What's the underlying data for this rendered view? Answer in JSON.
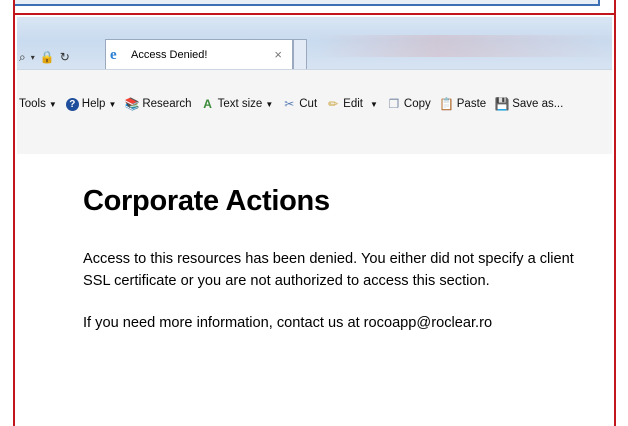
{
  "browser": {
    "tab_title": "Access Denied!",
    "tab_close": "×",
    "address_tools": [
      "search-icon",
      "dropdown-icon",
      "lock-icon",
      "refresh-icon"
    ]
  },
  "commandbar": {
    "items": [
      {
        "label": "Tools",
        "icon": "none",
        "dropdown": true
      },
      {
        "label": "Help",
        "icon": "help-icon",
        "dropdown": true
      },
      {
        "label": "Research",
        "icon": "research-icon",
        "dropdown": false
      },
      {
        "label": "Text size",
        "icon": "text-size-icon",
        "dropdown": true
      },
      {
        "label": "Cut",
        "icon": "scissors-icon",
        "dropdown": false
      },
      {
        "label": "Edit",
        "icon": "pencil-icon",
        "dropdown": true
      },
      {
        "label": "Copy",
        "icon": "copy-icon",
        "dropdown": false
      },
      {
        "label": "Paste",
        "icon": "clipboard-icon",
        "dropdown": false
      },
      {
        "label": "Save as...",
        "icon": "save-icon",
        "dropdown": false
      }
    ]
  },
  "page": {
    "heading": "Corporate Actions",
    "paragraph1": "Access to this resources has been denied. You either did not specify a client SSL certificate or you are not authorized to access this section.",
    "paragraph2": "If you need more information, contact us at rocoapp@roclear.ro"
  },
  "colors": {
    "frame": "#c0161c",
    "chrome": "#d9e6f4"
  }
}
